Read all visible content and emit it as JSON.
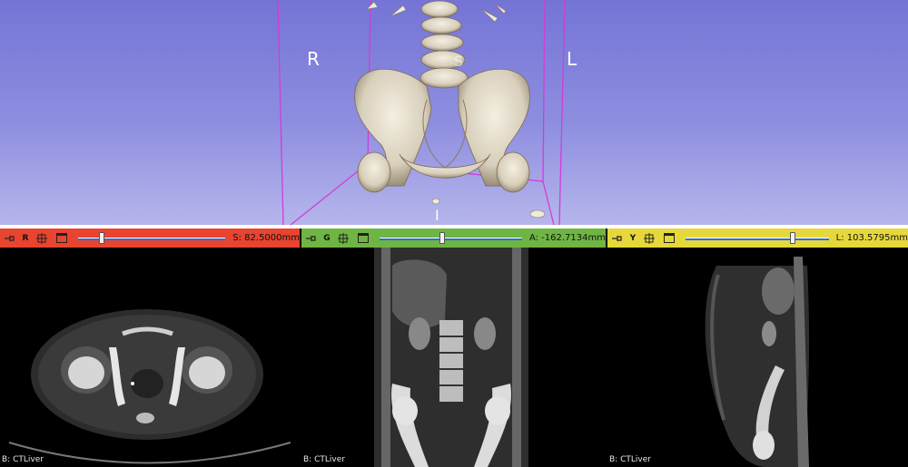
{
  "view3d": {
    "orientation": {
      "left": "R",
      "right": "L",
      "bottom": "I",
      "top": "S"
    },
    "colors": {
      "background_top": "#7474d6",
      "background_bottom": "#b6b6ec",
      "box": "#d33cd6"
    }
  },
  "slices": [
    {
      "id": "red",
      "letter": "R",
      "bar_color": "#e8442f",
      "readout": "S: 82.5000mm",
      "slider_position_percent": 16,
      "label": "B: CTLiver"
    },
    {
      "id": "green",
      "letter": "G",
      "bar_color": "#6fb543",
      "readout": "A: -162.7134mm",
      "slider_position_percent": 44,
      "label": "B: CTLiver"
    },
    {
      "id": "yellow",
      "letter": "Y",
      "bar_color": "#e6d83a",
      "readout": "L: 103.5795mm",
      "slider_position_percent": 75,
      "label": "B: CTLiver"
    }
  ]
}
